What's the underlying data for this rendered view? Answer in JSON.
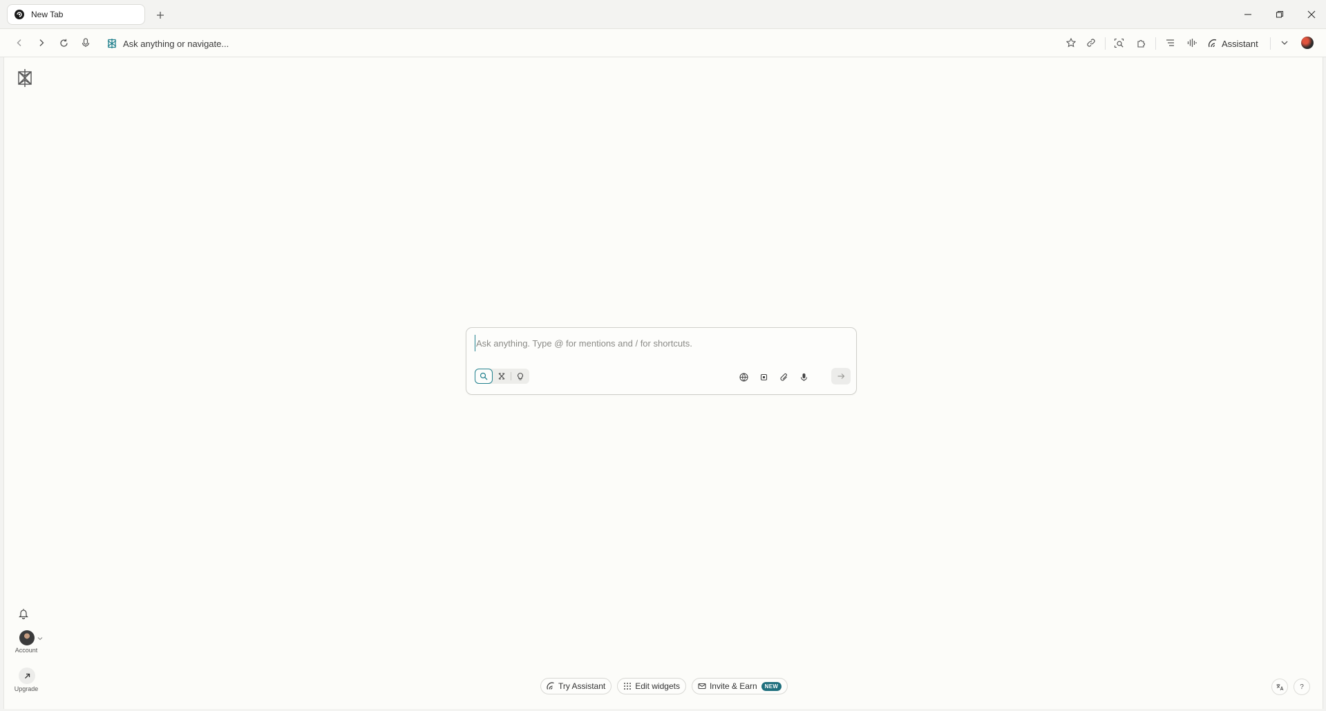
{
  "tab": {
    "title": "New Tab",
    "favicon_icon": "perplexity-icon"
  },
  "window_controls": [
    "minimize-icon",
    "restore-icon",
    "close-icon"
  ],
  "toolbar": {
    "omnibox_placeholder": "Ask anything or navigate...",
    "assistant_label": "Assistant"
  },
  "search": {
    "placeholder": "Ask anything. Type @ for mentions and / for shortcuts.",
    "accent_color": "#20808d"
  },
  "sidebar": {
    "account_label": "Account",
    "upgrade_label": "Upgrade"
  },
  "footer": {
    "try_assistant": "Try Assistant",
    "edit_widgets": "Edit widgets",
    "invite_earn": "Invite & Earn",
    "new_badge": "NEW",
    "help_label": "?"
  }
}
